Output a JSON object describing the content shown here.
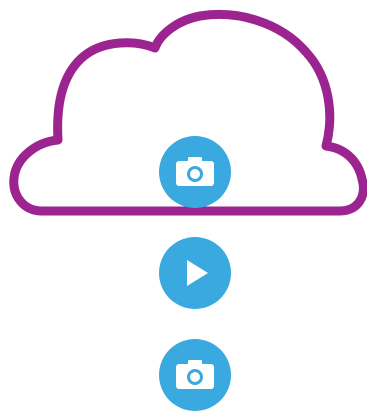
{
  "colors": {
    "cloud_outline": "#9b2490",
    "cloud_fill": "#ffffff",
    "button_fill": "#3aa9e0",
    "icon_fill": "#ffffff",
    "background": "#ffffff"
  },
  "icons": {
    "cloud": "cloud-icon",
    "top": "camera-icon",
    "middle": "play-icon",
    "bottom": "camera-icon"
  }
}
